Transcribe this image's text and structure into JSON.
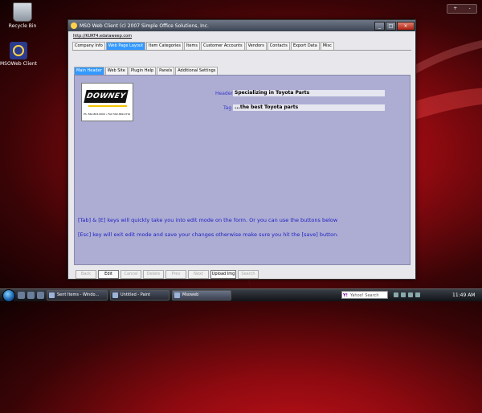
{
  "desktop": {
    "icons": [
      {
        "label": "Recycle Bin"
      },
      {
        "label": "MSOWeb Client"
      }
    ]
  },
  "window": {
    "title": "MSO Web Client (c) 2007 Simple Office Solutions, Inc.",
    "buttons": {
      "minimize": "_",
      "maximize": "□",
      "close": "×"
    },
    "url": "http://KURT4.edataweep.com",
    "tabs": [
      "Company Info",
      "Web Page Layout",
      "Item Categories",
      "Items",
      "Customer Accounts",
      "Vendors",
      "Contacts",
      "Export Data",
      "Misc"
    ],
    "active_tab": "Web Page Layout",
    "subtabs": [
      "Main Header",
      "Web Site",
      "Plugin Help",
      "Panels",
      "Additional Settings"
    ],
    "active_subtab": "Main Header",
    "logo": {
      "brand": "DOWNEY",
      "phone": "Ph. 562-863-0000  •  FAX 562-869-0710"
    },
    "fields": {
      "header_label": "Header",
      "header_value": "Specializing in Toyota Parts",
      "tag_label": "Tag",
      "tag_value": "...the best Toyota parts"
    },
    "hints": {
      "line1": "[Tab] & [E] keys will quickly take you into edit mode on the form. Or you can use the buttons below",
      "line2": "[Esc] key will exit edit mode and save your changes otherwise make sure you hit the [save] button."
    },
    "buttons_bar": [
      "Back",
      "Edit",
      "Cancel",
      "Delete",
      "Prev",
      "Next",
      "Upload Img",
      "Search"
    ],
    "enabled_buttons": [
      "Edit",
      "Upload Img"
    ]
  },
  "taskbar": {
    "tasks": [
      "Sent Items - Windo...",
      "Untitled - Paint",
      "Msoweb"
    ],
    "active_task": "Msoweb",
    "search_placeholder": "Yahoo! Search",
    "clock": "11:49 AM"
  },
  "gadget": {
    "plus": "+",
    "minus": "-"
  }
}
